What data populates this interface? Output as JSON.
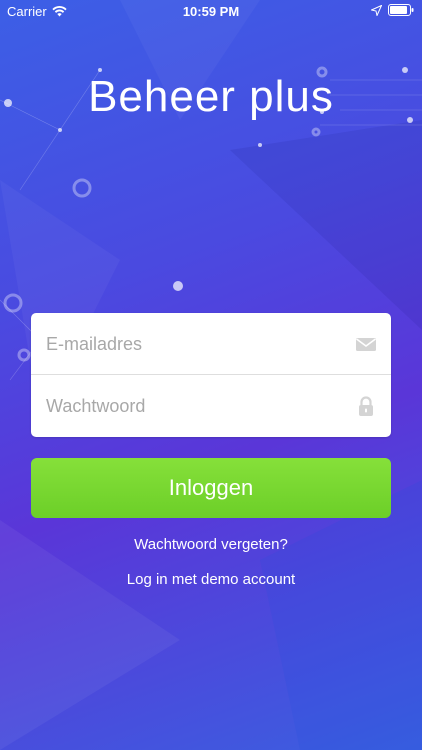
{
  "status_bar": {
    "carrier": "Carrier",
    "time": "10:59 PM",
    "icons": [
      "wifi-icon",
      "location-icon",
      "battery-icon"
    ]
  },
  "app": {
    "title": "Beheer plus"
  },
  "login_form": {
    "email_placeholder": "E-mailadres",
    "email_value": "",
    "password_placeholder": "Wachtwoord",
    "password_value": "",
    "email_icon": "envelope-icon",
    "password_icon": "lock-icon",
    "submit_label": "Inloggen"
  },
  "links": {
    "forgot_password": "Wachtwoord vergeten?",
    "demo_login": "Log in met demo account"
  },
  "colors": {
    "background_start": "#3c5fe6",
    "background_mid": "#5a36d8",
    "button_green": "#78d832",
    "text_white": "#ffffff",
    "placeholder_gray": "#a8a8a8"
  }
}
